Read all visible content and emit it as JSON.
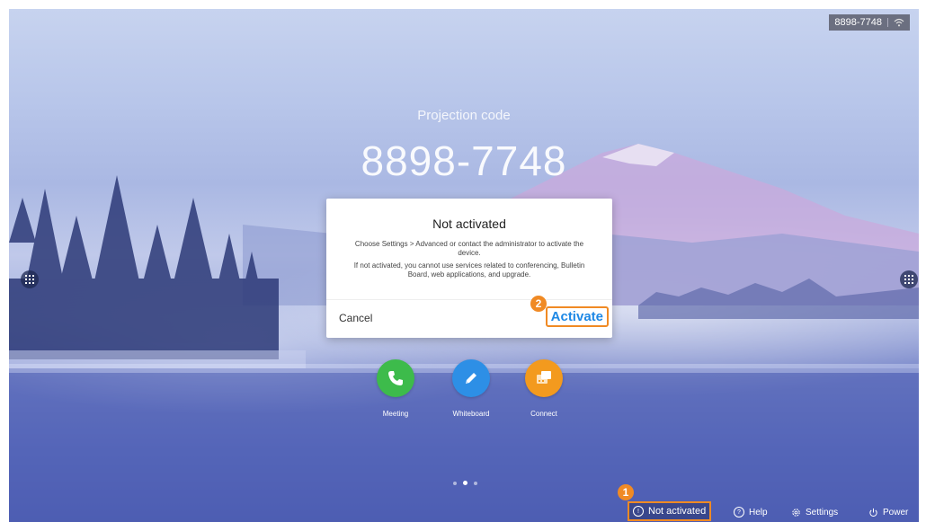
{
  "status_bar": {
    "code": "8898-7748",
    "wifi_icon": "wifi-icon"
  },
  "projection": {
    "label": "Projection code",
    "code": "8898-7748"
  },
  "dialog": {
    "title": "Not activated",
    "message_1": "Choose Settings > Advanced or contact the administrator to activate the device.",
    "message_2": "If not activated, you cannot use services related to conferencing, Bulletin Board, web applications, and upgrade.",
    "cancel_label": "Cancel",
    "activate_label": "Activate"
  },
  "callouts": {
    "first": "1",
    "second": "2"
  },
  "apps": [
    {
      "label": "Meeting",
      "icon": "phone-icon",
      "color": "#3dbb4b"
    },
    {
      "label": "Whiteboard",
      "icon": "pen-icon",
      "color": "#2d8fe6"
    },
    {
      "label": "Connect",
      "icon": "connect-icon",
      "color": "#f39a1e"
    }
  ],
  "pager": {
    "pages": 3,
    "active_index": 1
  },
  "bottom_bar": {
    "not_activated": "Not activated",
    "help": "Help",
    "settings": "Settings",
    "power": "Power"
  },
  "colors": {
    "accent": "#f08a24",
    "link": "#1e88e5"
  }
}
